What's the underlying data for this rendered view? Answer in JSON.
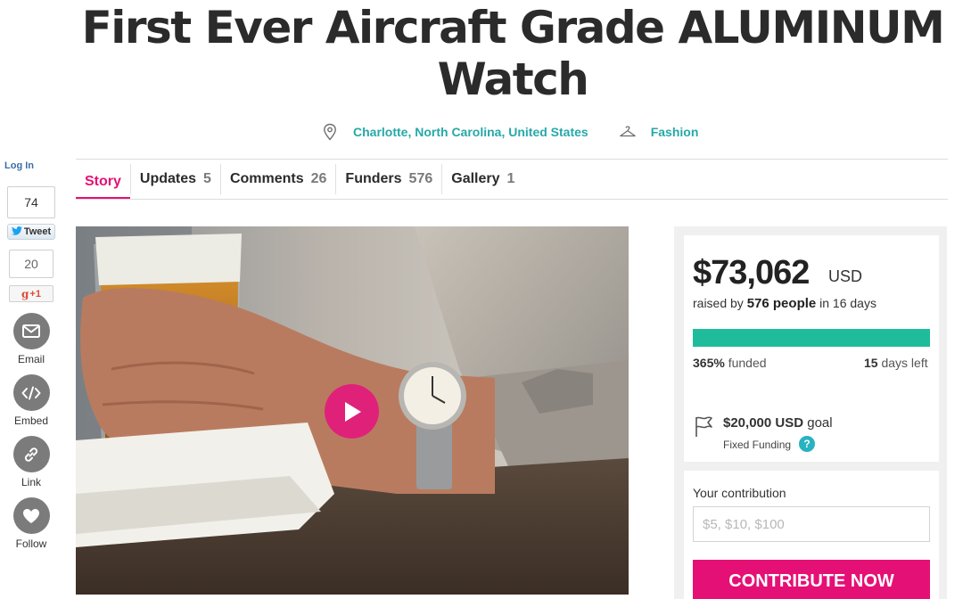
{
  "campaign": {
    "title": "First Ever Aircraft Grade ALUMINUM Watch",
    "location": "Charlotte, North Carolina, United States",
    "category": "Fashion"
  },
  "tabs": [
    {
      "label": "Story",
      "count": ""
    },
    {
      "label": "Updates",
      "count": "5"
    },
    {
      "label": "Comments",
      "count": "26"
    },
    {
      "label": "Funders",
      "count": "576"
    },
    {
      "label": "Gallery",
      "count": "1"
    }
  ],
  "social": {
    "login_label": "Log In",
    "tweet_count": "74",
    "tweet_label": "Tweet",
    "gplus_count": "20",
    "gplus_label": "+1",
    "actions": [
      {
        "label": "Email",
        "icon": "envelope-icon"
      },
      {
        "label": "Embed",
        "icon": "code-icon"
      },
      {
        "label": "Link",
        "icon": "link-icon"
      },
      {
        "label": "Follow",
        "icon": "heart-icon"
      }
    ]
  },
  "funding": {
    "amount": "$73,062",
    "currency": "USD",
    "raised_prefix": "raised by",
    "people": "576 people",
    "raised_suffix": "in 16 days",
    "progress_fraction": 1.0,
    "funded_percent": "365%",
    "funded_label": "funded",
    "days_left": "15",
    "days_left_label": "days left",
    "goal_amount": "$20,000",
    "goal_currency": "USD",
    "goal_label": "goal",
    "funding_type": "Fixed Funding",
    "help_label": "?"
  },
  "contribution": {
    "label": "Your contribution",
    "placeholder": "$5, $10, $100",
    "button_label": "CONTRIBUTE NOW"
  },
  "colors": {
    "accent": "#e51075",
    "link": "#27a8a8",
    "progress": "#1fbc9c",
    "help": "#27b3c0"
  }
}
